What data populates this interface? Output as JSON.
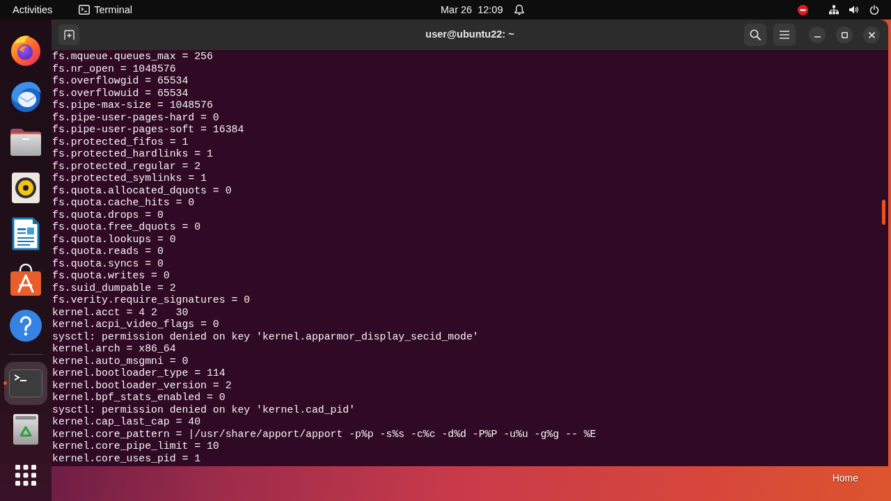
{
  "top_bar": {
    "activities": "Activities",
    "app_menu": {
      "label": "Terminal"
    },
    "clock": "Mar 26  12:09"
  },
  "dock": {
    "favorites": [
      {
        "kind": "browser",
        "running": false,
        "selected": false
      },
      {
        "kind": "mail",
        "running": false,
        "selected": false
      },
      {
        "kind": "files",
        "running": false,
        "selected": false
      },
      {
        "kind": "music",
        "running": false,
        "selected": false
      },
      {
        "kind": "writer",
        "running": false,
        "selected": false
      },
      {
        "kind": "software",
        "running": false,
        "selected": false
      },
      {
        "kind": "help",
        "running": false,
        "selected": false
      }
    ],
    "others": [
      {
        "kind": "terminal",
        "running": true,
        "selected": true
      },
      {
        "kind": "trash",
        "running": false,
        "selected": false
      }
    ]
  },
  "terminal": {
    "title": "user@ubuntu22: ~",
    "lines": [
      "fs.mqueue.queues_max = 256",
      "fs.nr_open = 1048576",
      "fs.overflowgid = 65534",
      "fs.overflowuid = 65534",
      "fs.pipe-max-size = 1048576",
      "fs.pipe-user-pages-hard = 0",
      "fs.pipe-user-pages-soft = 16384",
      "fs.protected_fifos = 1",
      "fs.protected_hardlinks = 1",
      "fs.protected_regular = 2",
      "fs.protected_symlinks = 1",
      "fs.quota.allocated_dquots = 0",
      "fs.quota.cache_hits = 0",
      "fs.quota.drops = 0",
      "fs.quota.free_dquots = 0",
      "fs.quota.lookups = 0",
      "fs.quota.reads = 0",
      "fs.quota.syncs = 0",
      "fs.quota.writes = 0",
      "fs.suid_dumpable = 2",
      "fs.verity.require_signatures = 0",
      "kernel.acct = 4\t2\t30",
      "kernel.acpi_video_flags = 0",
      "sysctl: permission denied on key 'kernel.apparmor_display_secid_mode'",
      "kernel.arch = x86_64",
      "kernel.auto_msgmni = 0",
      "kernel.bootloader_type = 114",
      "kernel.bootloader_version = 2",
      "kernel.bpf_stats_enabled = 0",
      "sysctl: permission denied on key 'kernel.cad_pid'",
      "kernel.cap_last_cap = 40",
      "kernel.core_pattern = |/usr/share/apport/apport -p%p -s%s -c%c -d%d -P%P -u%u -g%g -- %E",
      "kernel.core_pipe_limit = 10",
      "kernel.core_uses_pid = 1"
    ]
  },
  "desktop": {
    "icons": [
      {
        "label": "Home"
      }
    ]
  }
}
